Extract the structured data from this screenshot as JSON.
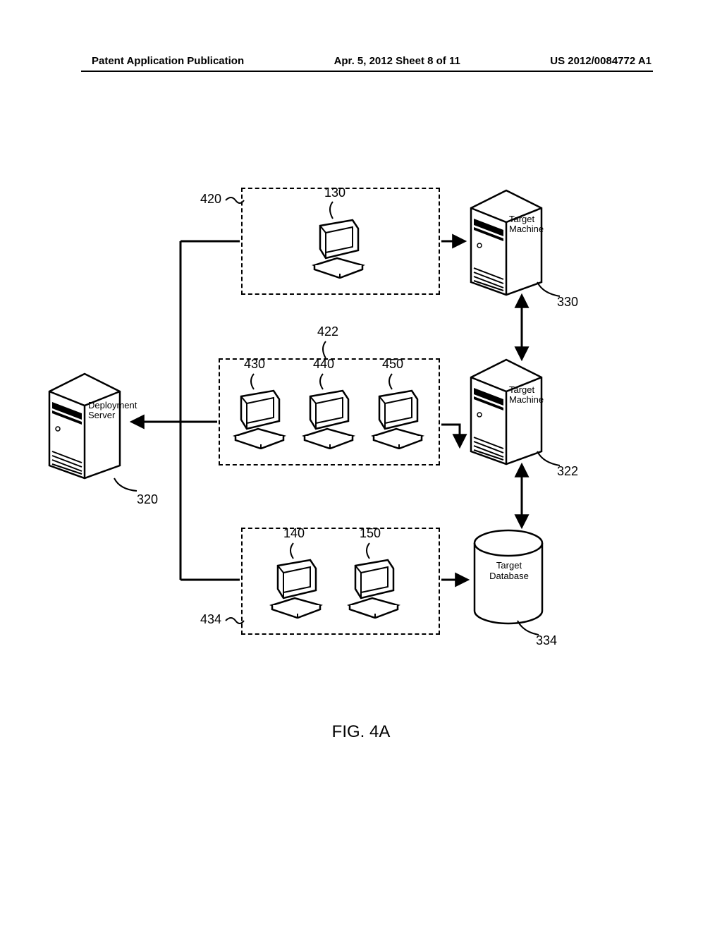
{
  "header": {
    "left": "Patent Application Publication",
    "center": "Apr. 5, 2012   Sheet 8 of 11",
    "right": "US 2012/0084772 A1"
  },
  "labels": {
    "deployment_server": "Deployment\nServer",
    "target_machine_top": "Target\nMachine",
    "target_machine_mid": "Target\nMachine",
    "target_database": "Target\nDatabase"
  },
  "refs": {
    "r420": "420",
    "r130": "130",
    "r330": "330",
    "r422": "422",
    "r430": "430",
    "r440": "440",
    "r450": "450",
    "r320": "320",
    "r322": "322",
    "r434": "434",
    "r140": "140",
    "r150": "150",
    "r334": "334"
  },
  "figure_caption": "FIG. 4A"
}
